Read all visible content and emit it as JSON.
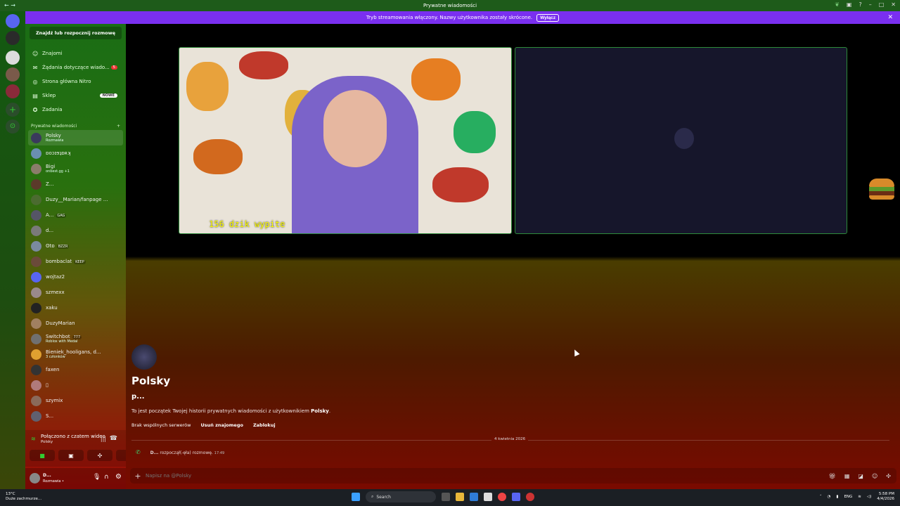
{
  "window": {
    "title": "Prywatne wiadomości"
  },
  "banner": {
    "text": "Tryb streamowania włączony. Nazwy użytkownika zostały skrócone.",
    "button": "Wyłącz"
  },
  "sidebar": {
    "find_button": "Znajdź lub rozpocznij rozmowę",
    "nav": [
      {
        "label": "Znajomi",
        "icon": "friends-icon"
      },
      {
        "label": "Żądania dotyczące wiado...",
        "icon": "mail-icon",
        "badge": "5"
      },
      {
        "label": "Strona główna Nitro",
        "icon": "nitro-icon"
      },
      {
        "label": "Sklep",
        "icon": "shop-icon",
        "tag": "NOWE"
      },
      {
        "label": "Zadania",
        "icon": "quests-icon"
      }
    ],
    "section_header": "Prywatne wiadomości",
    "dms": [
      {
        "name": "Polsky",
        "sub": "Rozmawia",
        "color": "#3a3a5c"
      },
      {
        "name": "ɒoɔɪɘʇɒʀʞ",
        "sub": "",
        "color": "#6a8fb0"
      },
      {
        "name": "Bigi",
        "sub": "onbest.gg +1",
        "color": "#8a7d6a"
      },
      {
        "name": "Z...",
        "sub": "",
        "color": "#5b3a2a"
      },
      {
        "name": "Duzy__Marian/fanpage ...",
        "sub": "",
        "color": "#4b6b30"
      },
      {
        "name": "A...",
        "sub": "",
        "tag": "GAG",
        "color": "#556"
      },
      {
        "name": "d...",
        "sub": "",
        "color": "#7a7a7a"
      },
      {
        "name": "ʘtɒ",
        "sub": "",
        "tag": "BZZR",
        "color": "#7a8aa0"
      },
      {
        "name": "bombaclat",
        "sub": "",
        "tag": "KEEP",
        "color": "#6b4a3a"
      },
      {
        "name": "wojtaz2",
        "sub": "",
        "color": "#5865f2"
      },
      {
        "name": "szmexx",
        "sub": "",
        "color": "#9a8a8a"
      },
      {
        "name": "xaku",
        "sub": "",
        "color": "#222"
      },
      {
        "name": "DuzyMarian",
        "sub": "",
        "color": "#a08060"
      },
      {
        "name": "Switchbot",
        "sub": "Roblox with Medal",
        "tag": "777",
        "color": "#707070"
      },
      {
        "name": "Bieniek_hooligans, d...",
        "sub": "3 członków",
        "color": "#e0a030"
      },
      {
        "name": "faxen",
        "sub": "",
        "color": "#333"
      },
      {
        "name": "▯",
        "sub": "",
        "color": "#b07a7a"
      },
      {
        "name": "szymix",
        "sub": "",
        "color": "#8a6a5a"
      },
      {
        "name": "S...",
        "sub": "",
        "color": "#606070"
      }
    ],
    "voice": {
      "title": "Połączono z czatem wideo",
      "channel": "Polsky"
    },
    "user": {
      "name": "D...",
      "status": "Rozmawia •"
    }
  },
  "video": {
    "caption": "156 dzik wypite"
  },
  "profile": {
    "name": "Polsky",
    "subname": "p...",
    "description_prefix": "To jest początek Twojej historii prywatnych wiadomości z użytkownikiem ",
    "description_user": "Polsky",
    "description_suffix": ".",
    "no_servers": "Brak wspólnych serwerów",
    "remove_friend": "Usuń znajomego",
    "block": "Zablokuj"
  },
  "messages": {
    "date": "4 kwietnia 2026",
    "call_user": "D...",
    "call_text": " rozpoczął(-ęła) rozmowę.",
    "call_time": "17:49"
  },
  "input": {
    "placeholder": "Napisz na @Polsky"
  },
  "taskbar": {
    "temp": "13°C",
    "weather": "Duże zachmurze...",
    "search": "Search",
    "lang": "ENG",
    "time": "5:58 PM",
    "date": "4/4/2026"
  }
}
